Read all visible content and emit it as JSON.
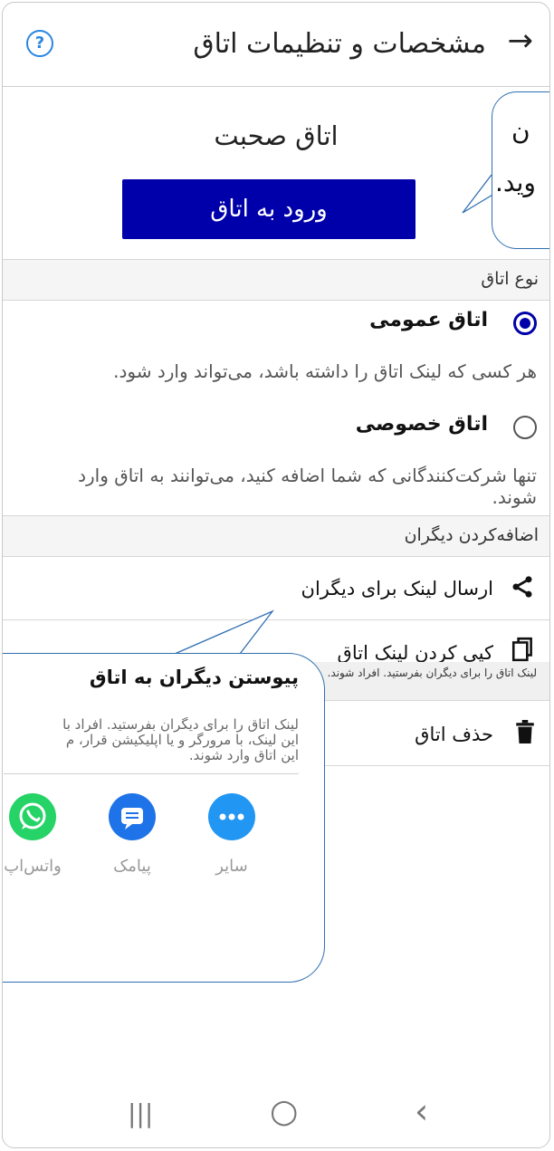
{
  "header": {
    "title": "مشخصات و تنظیمات اتاق",
    "back_icon": "→",
    "help_icon": "?"
  },
  "room": {
    "name": "اتاق صحبت",
    "enter_label": "ورود به اتاق"
  },
  "tooltip_top": {
    "line1": "ن",
    "line2": "وید."
  },
  "room_type": {
    "header": "نوع اتاق",
    "options": [
      {
        "label": "اتاق عمومی",
        "desc": "هر کسی که لینک اتاق را داشته باشد، می‌تواند وارد شود.",
        "selected": true
      },
      {
        "label": "اتاق خصوصی",
        "desc": "تنها شرکت‌کنندگانی که شما اضافه کنید، می‌توانند به اتاق وارد شوند.",
        "selected": false
      }
    ]
  },
  "add_others": {
    "header": "اضافه‌کردن دیگران",
    "send_link": "ارسال لینک برای دیگران",
    "copy_link": "کپی کردن لینک اتاق",
    "note": "لینک اتاق را برای دیگران بفرستید. افراد شوند."
  },
  "delete_room": "حذف اتاق",
  "share_sheet": {
    "title": "پیوستن دیگران به اتاق",
    "desc_lines": [
      "لینک اتاق را برای دیگران بفرستید. افراد با",
      "این لینک، با مرورگر و یا اپلیکیشن قرار، م",
      "این اتاق وارد شوند."
    ],
    "apps": [
      {
        "name": "سایر",
        "color": "#2196f3"
      },
      {
        "name": "پیامک",
        "color": "#1e73e8"
      },
      {
        "name": "واتس‌اپ",
        "color": "#25d366"
      }
    ]
  },
  "nav": {
    "recent": "|||",
    "home": "○",
    "back": "‹"
  }
}
